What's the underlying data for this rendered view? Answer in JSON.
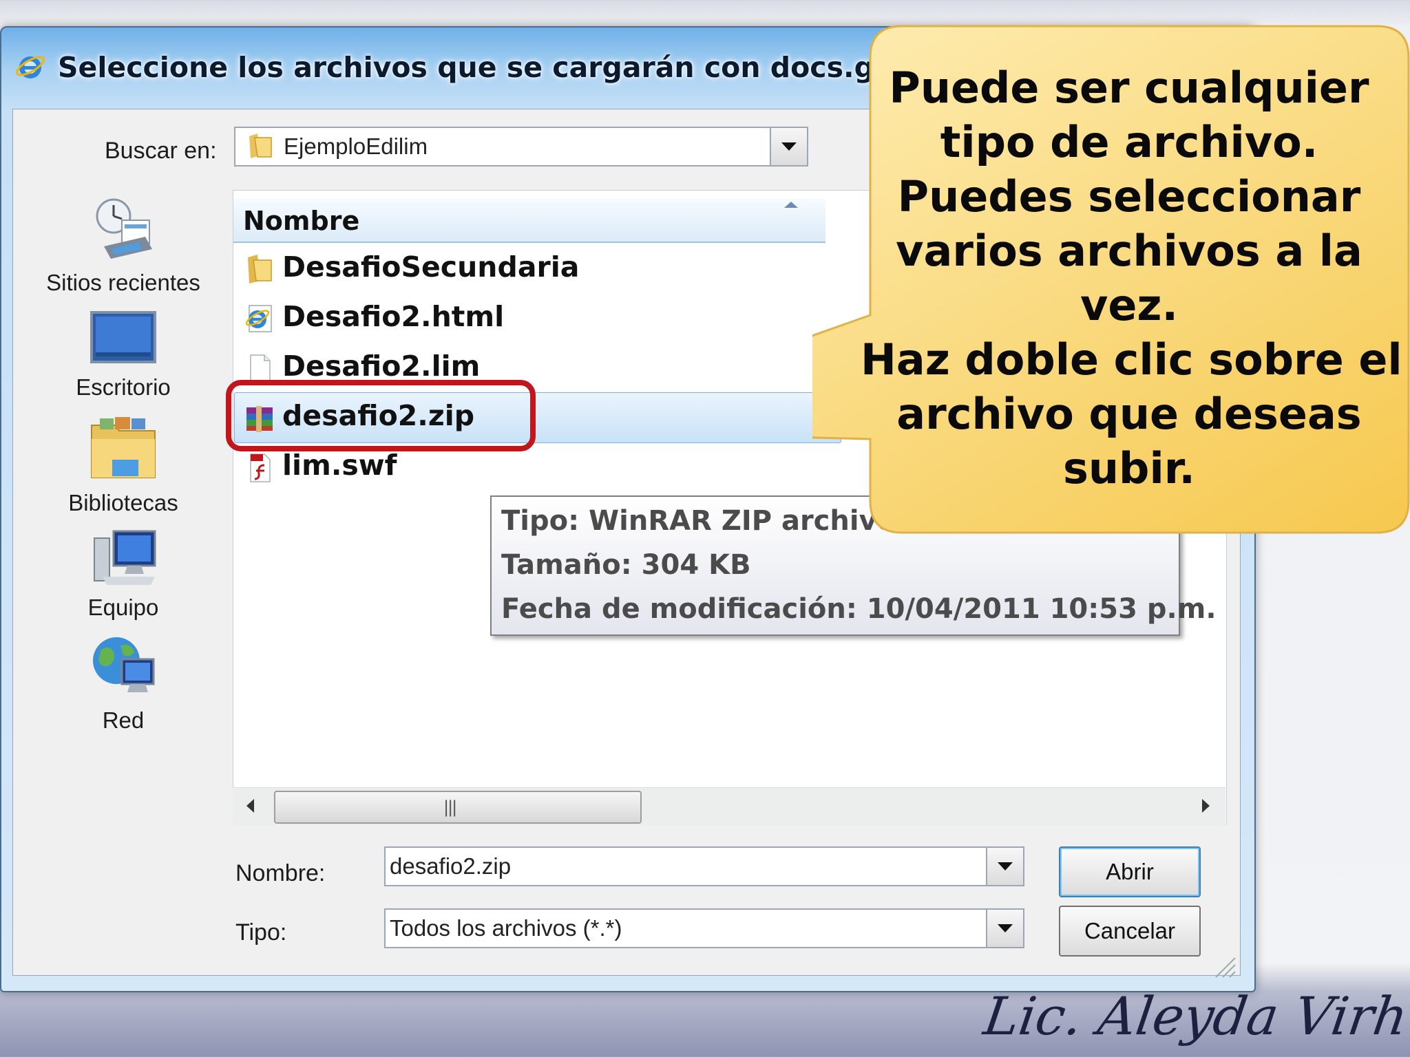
{
  "dialog": {
    "title": "Seleccione los archivos que se cargarán con docs.goog",
    "look_in_label": "Buscar en:",
    "look_in_value": "EjemploEdilim"
  },
  "places": [
    {
      "label": "Sitios recientes",
      "icon": "recent-places-icon"
    },
    {
      "label": "Escritorio",
      "icon": "desktop-icon"
    },
    {
      "label": "Bibliotecas",
      "icon": "libraries-icon"
    },
    {
      "label": "Equipo",
      "icon": "computer-icon"
    },
    {
      "label": "Red",
      "icon": "network-icon"
    }
  ],
  "file_list": {
    "column_header": "Nombre",
    "files": [
      {
        "name": "DesafioSecundaria",
        "icon": "folder-icon"
      },
      {
        "name": "Desafio2.html",
        "icon": "ie-html-icon"
      },
      {
        "name": "Desafio2.lim",
        "icon": "blank-file-icon"
      },
      {
        "name": "desafio2.zip",
        "icon": "winrar-zip-icon",
        "selected": true
      },
      {
        "name": "lim.swf",
        "icon": "flash-swf-icon"
      }
    ]
  },
  "tooltip": {
    "type": "Tipo: WinRAR ZIP archive",
    "size": "Tamaño: 304 KB",
    "modified": "Fecha de modificación: 10/04/2011 10:53 p.m."
  },
  "footer": {
    "name_label": "Nombre:",
    "name_value": "desafio2.zip",
    "type_label": "Tipo:",
    "type_value": "Todos los archivos (*.*)",
    "open_button": "Abrir",
    "cancel_button": "Cancelar"
  },
  "callout": {
    "lines": [
      "Puede ser cualquier",
      "tipo de archivo.",
      "Puedes seleccionar",
      "varios archivos a la",
      "vez.",
      "Haz doble clic sobre el",
      "archivo que deseas",
      "subir."
    ]
  },
  "signature": "Lic. Aleyda Virhuez",
  "colors": {
    "highlight_ring": "#c0161c",
    "callout_fill": "#fbd96a",
    "selection": "#c9e2f8"
  }
}
